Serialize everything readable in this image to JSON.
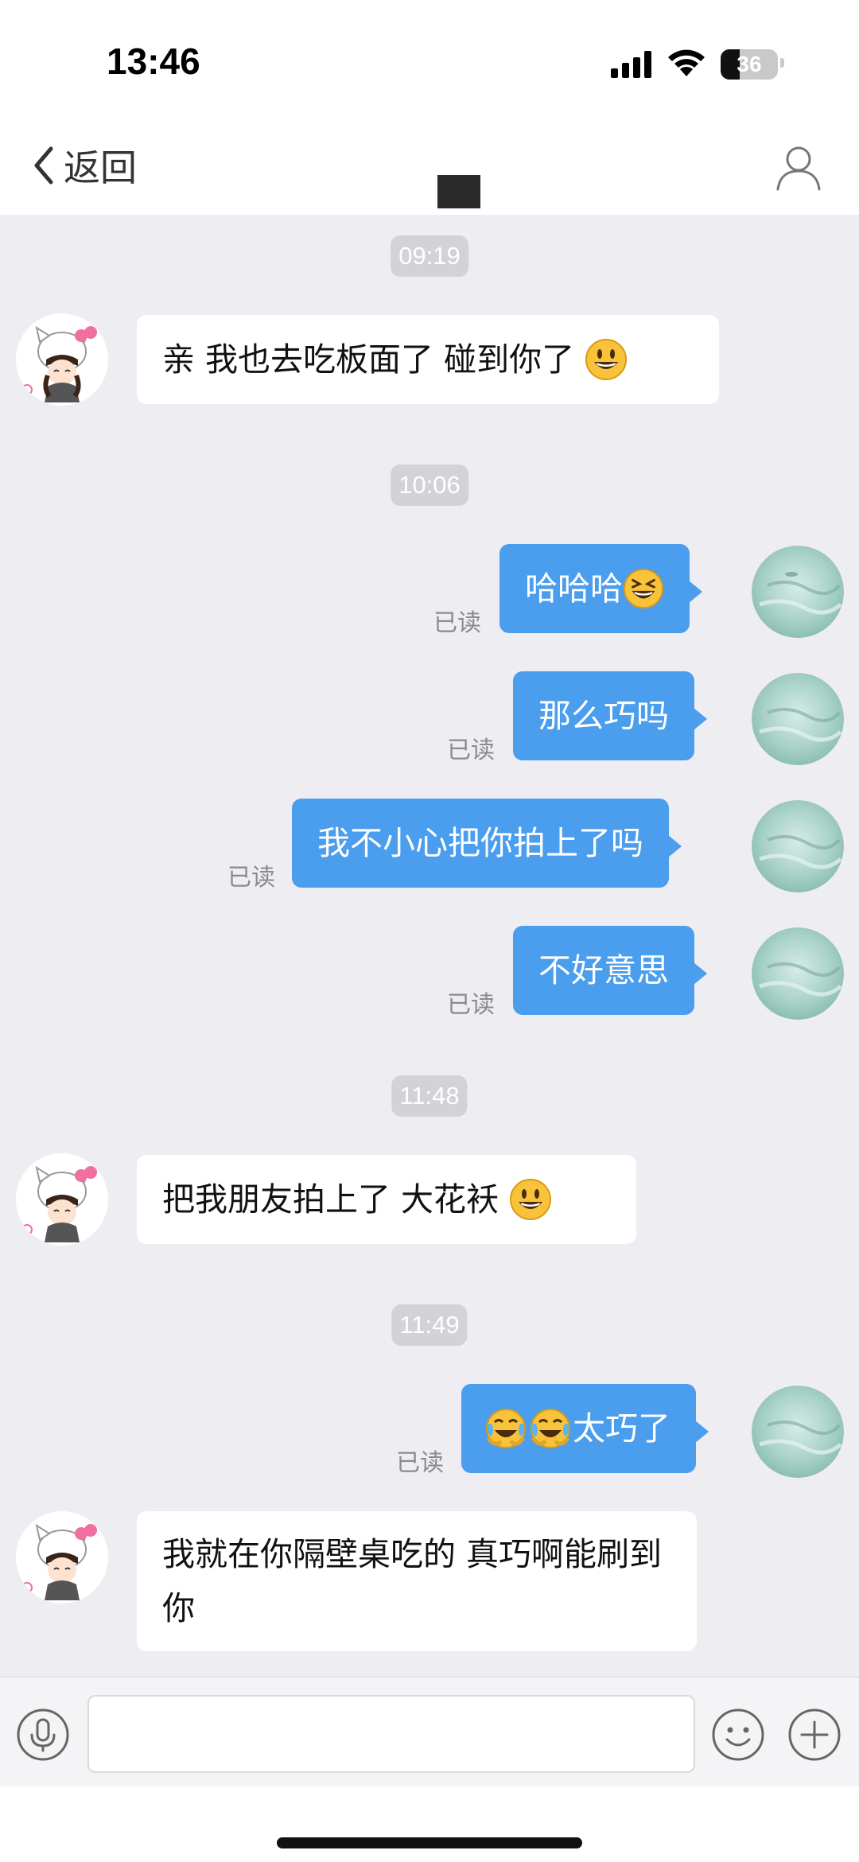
{
  "status_bar": {
    "time": "13:46",
    "battery": "36"
  },
  "nav": {
    "back_label": "返回",
    "profile_icon": "person-icon"
  },
  "messages": [
    {
      "type": "time",
      "text": "09:19"
    },
    {
      "type": "in",
      "text": "亲 我也去吃板面了  碰到你了",
      "emoji": "grinning-face-icon"
    },
    {
      "type": "time",
      "text": "10:06"
    },
    {
      "type": "out",
      "text": "哈哈哈",
      "emoji": "laughing-squinting-face-icon",
      "status": "已读"
    },
    {
      "type": "out",
      "text": "那么巧吗",
      "status": "已读"
    },
    {
      "type": "out",
      "text": "我不小心把你拍上了吗",
      "status": "已读"
    },
    {
      "type": "out",
      "text": "不好意思",
      "status": "已读"
    },
    {
      "type": "time",
      "text": "11:48"
    },
    {
      "type": "in",
      "text": "把我朋友拍上了 大花袄 ",
      "emoji": "grinning-face-icon"
    },
    {
      "type": "time",
      "text": "11:49"
    },
    {
      "type": "out",
      "text": "太巧了",
      "emoji": "crying-laughing-face-icon",
      "status": "已读"
    },
    {
      "type": "in",
      "text": "我就在你隔壁桌吃的  真巧啊能刷到你"
    }
  ],
  "input": {
    "placeholder": ""
  },
  "colors": {
    "outgoing_bubble": "#4b9ded",
    "chat_background": "#ededf2"
  }
}
